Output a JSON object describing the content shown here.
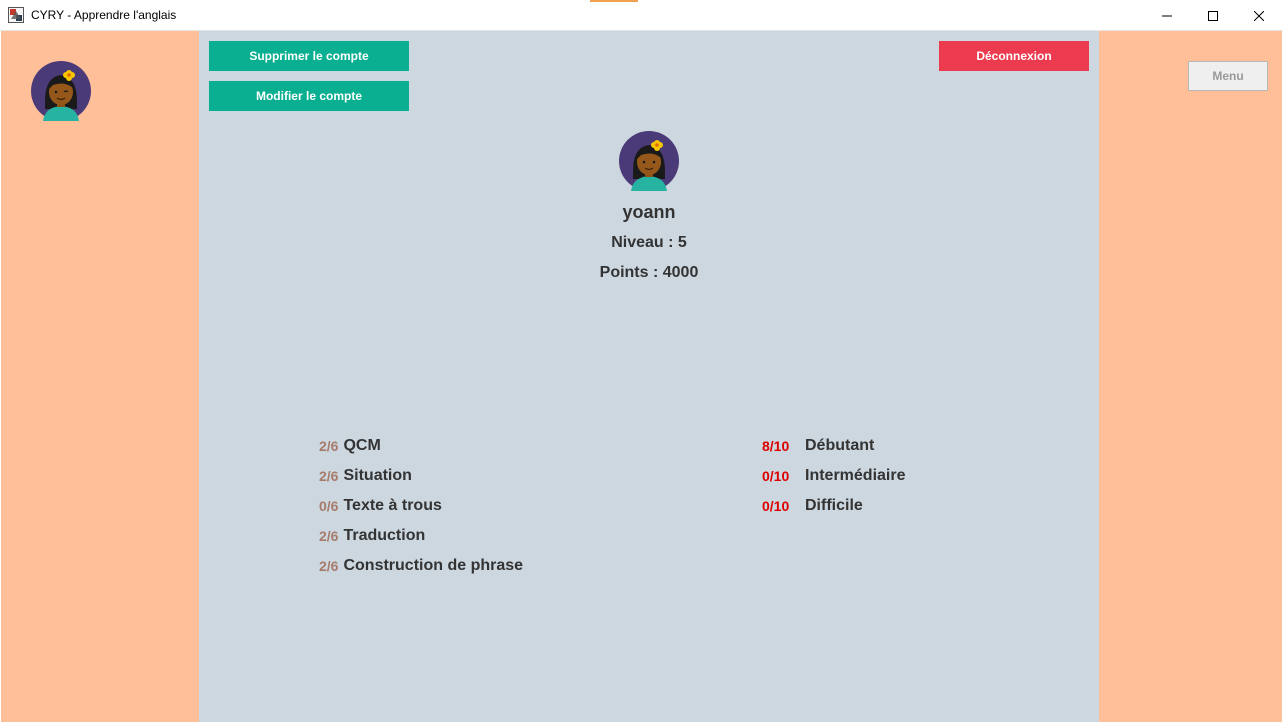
{
  "window": {
    "title": "CYRY - Apprendre l'anglais",
    "controls": [
      "minimize-icon",
      "maximize-icon",
      "close-icon"
    ]
  },
  "colors": {
    "side_panel": "#ffbf99",
    "center_panel": "#cdd7e0",
    "teal_button": "#0aaf91",
    "logout_button": "#ec3a4e",
    "score_brown": "#a67b6a",
    "score_red": "#dd0000"
  },
  "actions": {
    "delete_account": "Supprimer le compte",
    "edit_account": "Modifier le compte",
    "logout": "Déconnexion",
    "menu": "Menu"
  },
  "profile": {
    "avatar": "girl-avatar-icon",
    "username": "yoann",
    "level": "Niveau : 5",
    "points": "Points : 4000"
  },
  "exercise_types": [
    {
      "score": "2/6",
      "label": "QCM"
    },
    {
      "score": "2/6",
      "label": "Situation"
    },
    {
      "score": "0/6",
      "label": "Texte à trous"
    },
    {
      "score": "2/6",
      "label": "Traduction"
    },
    {
      "score": "2/6",
      "label": "Construction de phrase"
    }
  ],
  "difficulty_levels": [
    {
      "score": "8/10",
      "label": "Débutant"
    },
    {
      "score": "0/10",
      "label": "Intermédiaire"
    },
    {
      "score": "0/10",
      "label": "Difficile"
    }
  ]
}
